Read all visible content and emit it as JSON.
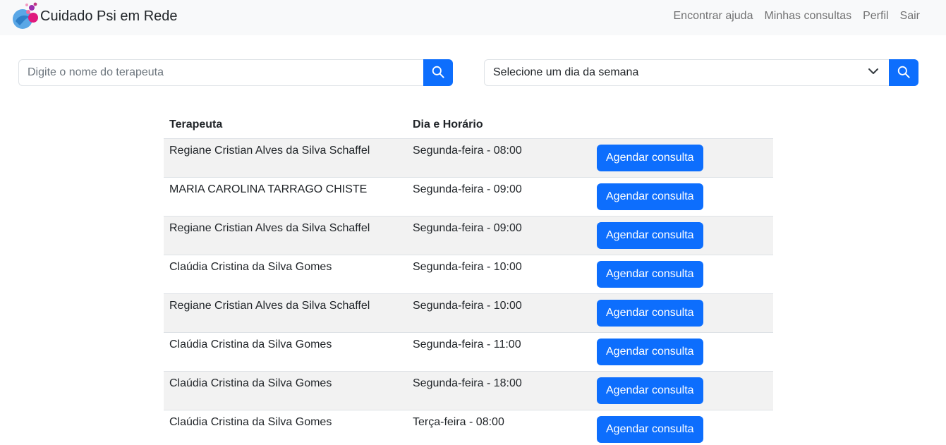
{
  "app": {
    "brand": "Cuidado Psi em Rede"
  },
  "nav": {
    "items": [
      "Encontrar ajuda",
      "Minhas consultas",
      "Perfil",
      "Sair"
    ]
  },
  "search": {
    "placeholder": "Digite o nome do terapeuta",
    "value": ""
  },
  "day_filter": {
    "selected": "Selecione um dia da semana"
  },
  "table": {
    "headers": [
      "Terapeuta",
      "Dia e Horário",
      ""
    ],
    "action_label": "Agendar consulta",
    "rows": [
      {
        "therapist": "Regiane Cristian Alves da Silva Schaffel",
        "slot": "Segunda-feira - 08:00"
      },
      {
        "therapist": "MARIA CAROLINA TARRAGO CHISTE",
        "slot": "Segunda-feira - 09:00"
      },
      {
        "therapist": "Regiane Cristian Alves da Silva Schaffel",
        "slot": "Segunda-feira - 09:00"
      },
      {
        "therapist": "Claúdia Cristina da Silva Gomes",
        "slot": "Segunda-feira - 10:00"
      },
      {
        "therapist": "Regiane Cristian Alves da Silva Schaffel",
        "slot": "Segunda-feira - 10:00"
      },
      {
        "therapist": "Claúdia Cristina da Silva Gomes",
        "slot": "Segunda-feira - 11:00"
      },
      {
        "therapist": "Claúdia Cristina da Silva Gomes",
        "slot": "Segunda-feira - 18:00"
      },
      {
        "therapist": "Claúdia Cristina da Silva Gomes",
        "slot": "Terça-feira - 08:00"
      }
    ]
  },
  "colors": {
    "primary": "#0d6efd",
    "navbar_bg": "#f8f9fa",
    "stripe": "#f2f2f2"
  },
  "icons": {
    "brand": "hands-bubbles-logo-icon",
    "search": "search-icon",
    "dropdown": "chevron-down-icon"
  }
}
